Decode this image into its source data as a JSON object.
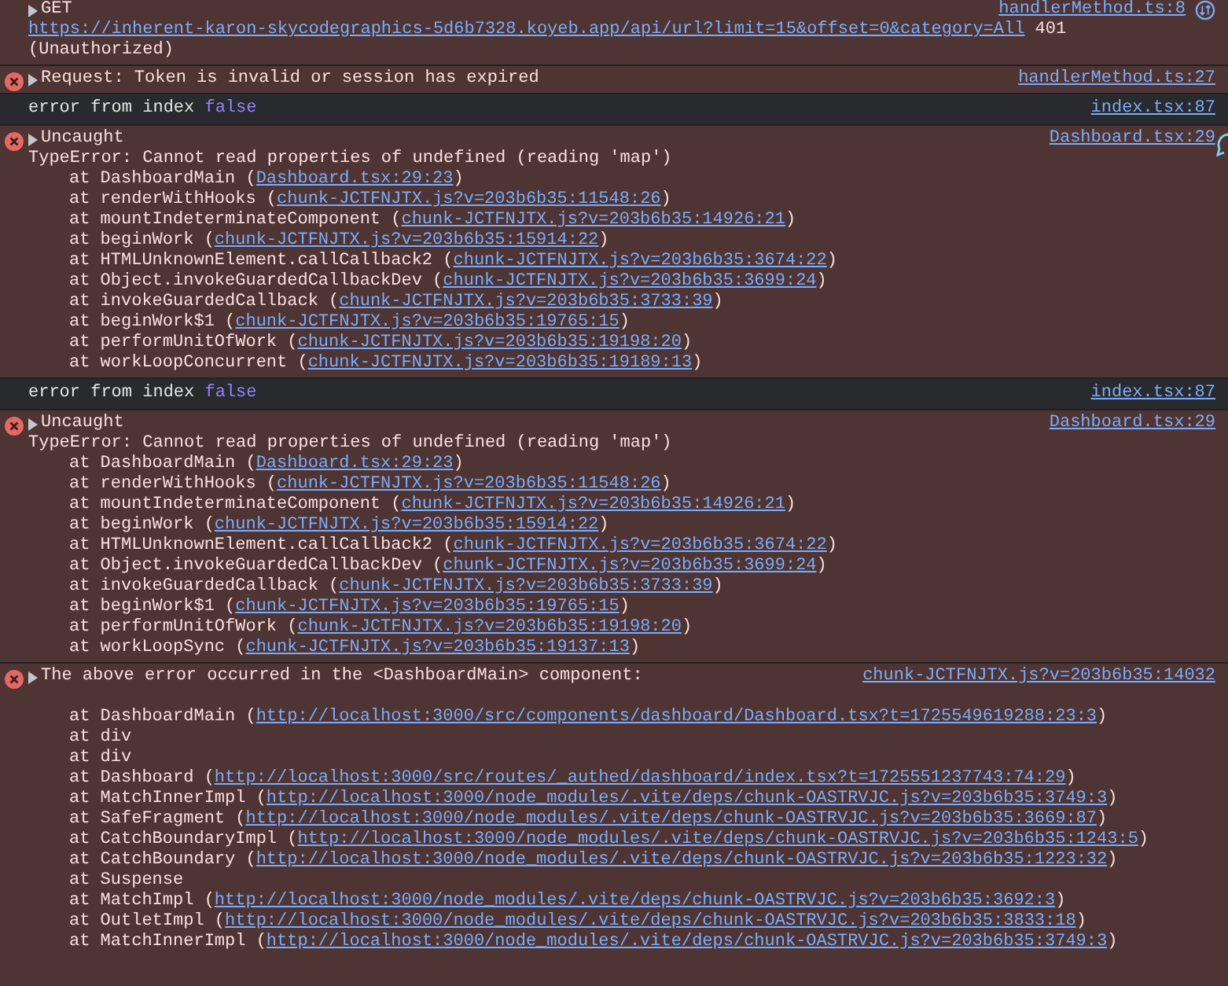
{
  "messages": [
    {
      "kind": "network",
      "text": "GET",
      "source": "handlerMethod.ts:8",
      "body": {
        "link": "https://inherent-karon-skycodegraphics-5d6b7328.koyeb.app/api/url?limit=15&offset=0&category=All",
        "end": " 401 (Unauthorized)"
      }
    },
    {
      "kind": "error",
      "text": "Request: Token is invalid or session has expired",
      "source": "handlerMethod.ts:27"
    },
    {
      "kind": "log",
      "text": "error from index ",
      "value": "false",
      "source": "index.tsx:87"
    },
    {
      "kind": "error",
      "text": "Uncaught",
      "source": "Dashboard.tsx:29",
      "detail": "TypeError: Cannot read properties of undefined (reading 'map')",
      "frames": [
        {
          "text": "at DashboardMain (",
          "link": "Dashboard.tsx:29:23",
          "end": ")"
        },
        {
          "text": "at renderWithHooks (",
          "link": "chunk-JCTFNJTX.js?v=203b6b35:11548:26",
          "end": ")"
        },
        {
          "text": "at mountIndeterminateComponent (",
          "link": "chunk-JCTFNJTX.js?v=203b6b35:14926:21",
          "end": ")"
        },
        {
          "text": "at beginWork (",
          "link": "chunk-JCTFNJTX.js?v=203b6b35:15914:22",
          "end": ")"
        },
        {
          "text": "at HTMLUnknownElement.callCallback2 (",
          "link": "chunk-JCTFNJTX.js?v=203b6b35:3674:22",
          "end": ")"
        },
        {
          "text": "at Object.invokeGuardedCallbackDev (",
          "link": "chunk-JCTFNJTX.js?v=203b6b35:3699:24",
          "end": ")"
        },
        {
          "text": "at invokeGuardedCallback (",
          "link": "chunk-JCTFNJTX.js?v=203b6b35:3733:39",
          "end": ")"
        },
        {
          "text": "at beginWork$1 (",
          "link": "chunk-JCTFNJTX.js?v=203b6b35:19765:15",
          "end": ")"
        },
        {
          "text": "at performUnitOfWork (",
          "link": "chunk-JCTFNJTX.js?v=203b6b35:19198:20",
          "end": ")"
        },
        {
          "text": "at workLoopConcurrent (",
          "link": "chunk-JCTFNJTX.js?v=203b6b35:19189:13",
          "end": ")"
        }
      ]
    },
    {
      "kind": "log",
      "text": "error from index ",
      "value": "false",
      "source": "index.tsx:87"
    },
    {
      "kind": "error",
      "text": "Uncaught",
      "source": "Dashboard.tsx:29",
      "detail": "TypeError: Cannot read properties of undefined (reading 'map')",
      "frames": [
        {
          "text": "at DashboardMain (",
          "link": "Dashboard.tsx:29:23",
          "end": ")"
        },
        {
          "text": "at renderWithHooks (",
          "link": "chunk-JCTFNJTX.js?v=203b6b35:11548:26",
          "end": ")"
        },
        {
          "text": "at mountIndeterminateComponent (",
          "link": "chunk-JCTFNJTX.js?v=203b6b35:14926:21",
          "end": ")"
        },
        {
          "text": "at beginWork (",
          "link": "chunk-JCTFNJTX.js?v=203b6b35:15914:22",
          "end": ")"
        },
        {
          "text": "at HTMLUnknownElement.callCallback2 (",
          "link": "chunk-JCTFNJTX.js?v=203b6b35:3674:22",
          "end": ")"
        },
        {
          "text": "at Object.invokeGuardedCallbackDev (",
          "link": "chunk-JCTFNJTX.js?v=203b6b35:3699:24",
          "end": ")"
        },
        {
          "text": "at invokeGuardedCallback (",
          "link": "chunk-JCTFNJTX.js?v=203b6b35:3733:39",
          "end": ")"
        },
        {
          "text": "at beginWork$1 (",
          "link": "chunk-JCTFNJTX.js?v=203b6b35:19765:15",
          "end": ")"
        },
        {
          "text": "at performUnitOfWork (",
          "link": "chunk-JCTFNJTX.js?v=203b6b35:19198:20",
          "end": ")"
        },
        {
          "text": "at workLoopSync (",
          "link": "chunk-JCTFNJTX.js?v=203b6b35:19137:13",
          "end": ")"
        }
      ]
    },
    {
      "kind": "error",
      "text": "The above error occurred in the <DashboardMain> component:",
      "source": "chunk-JCTFNJTX.js?v=203b6b35:14032",
      "blank_line": true,
      "frames": [
        {
          "text": "at DashboardMain (",
          "link": "http://localhost:3000/src/components/dashboard/Dashboard.tsx?t=1725549619288:23:3",
          "end": ")"
        },
        {
          "text": "at div"
        },
        {
          "text": "at div"
        },
        {
          "text": "at Dashboard (",
          "link": "http://localhost:3000/src/routes/_authed/dashboard/index.tsx?t=1725551237743:74:29",
          "end": ")"
        },
        {
          "text": "at MatchInnerImpl (",
          "link": "http://localhost:3000/node_modules/.vite/deps/chunk-OASTRVJC.js?v=203b6b35:3749:3",
          "end": ")"
        },
        {
          "text": "at SafeFragment (",
          "link": "http://localhost:3000/node_modules/.vite/deps/chunk-OASTRVJC.js?v=203b6b35:3669:87",
          "end": ")"
        },
        {
          "text": "at CatchBoundaryImpl (",
          "link": "http://localhost:3000/node_modules/.vite/deps/chunk-OASTRVJC.js?v=203b6b35:1243:5",
          "end": ")"
        },
        {
          "text": "at CatchBoundary (",
          "link": "http://localhost:3000/node_modules/.vite/deps/chunk-OASTRVJC.js?v=203b6b35:1223:32",
          "end": ")"
        },
        {
          "text": "at Suspense"
        },
        {
          "text": "at MatchImpl (",
          "link": "http://localhost:3000/node_modules/.vite/deps/chunk-OASTRVJC.js?v=203b6b35:3692:3",
          "end": ")"
        },
        {
          "text": "at OutletImpl (",
          "link": "http://localhost:3000/node_modules/.vite/deps/chunk-OASTRVJC.js?v=203b6b35:3833:18",
          "end": ")"
        },
        {
          "text": "at MatchInnerImpl (",
          "link": "http://localhost:3000/node_modules/.vite/deps/chunk-OASTRVJC.js?v=203b6b35:3749:3",
          "end": ")"
        }
      ]
    }
  ]
}
